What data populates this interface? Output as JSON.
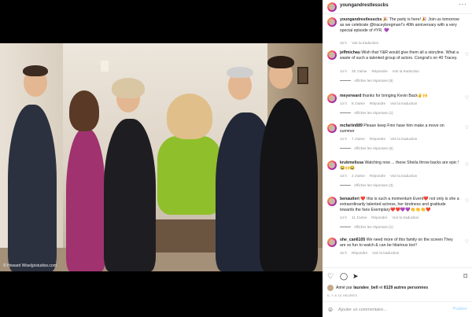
{
  "post": {
    "account": "youngandrestlesscbs",
    "photo_credit": "© Howard Wise/jpistudios.com",
    "caption": {
      "user": "youngandrestlesscbs",
      "text": "🎉 The party is here! 🎉 Join us tomorrow as we celebrate @traceybregman!'s 40th anniversary with a very special episode of #YR. 💜",
      "time": "15 h",
      "translate": "Voir la traduction"
    }
  },
  "comments": [
    {
      "user": "jeffmichau",
      "text": "Wish that Y&R would give them all a storyline. What a waste of such a talented group of actors. Congrat's on 40 Tracey.",
      "time": "14 h",
      "likes": "25 J'aime",
      "reply": "Répondre",
      "translate": "Voir la traduction",
      "replies": "Afficher les réponses (8)"
    },
    {
      "user": "meyerward",
      "text": "thanks for bringing Kevin Back✌️🙌",
      "time": "14 h",
      "likes": "8 J'aime",
      "reply": "Répondre",
      "translate": "Voir la traduction",
      "replies": "Afficher les réponses (1)"
    },
    {
      "user": "mcfarlin889",
      "text": "Please keep Finn have him make a move on summer",
      "time": "14 h",
      "likes": "7 J'aime",
      "reply": "Répondre",
      "translate": "Voir la traduction",
      "replies": "Afficher les réponses (6)"
    },
    {
      "user": "krukmelissa",
      "text": "Watching now ... these Sheila throw backs are epic ! 😂🙌😂",
      "time": "13 h",
      "likes": "2 J'aime",
      "reply": "Répondre",
      "translate": "Voir la traduction",
      "replies": "Afficher les réponses (3)"
    },
    {
      "user": "benautleri",
      "text": "❤️ this is such a momentum Event❤️ not only is she a extraordinarily talented actress, her kindness and gratitude towards the fans Exemplary❤️❤️💜💜👏👏👏❤️",
      "time": "14 h",
      "likes": "11 J'aime",
      "reply": "Répondre",
      "translate": "Voir la traduction",
      "replies": "Afficher les réponses (1)"
    },
    {
      "user": "she_can6105",
      "text": "We need more of this family on the screen They are so fun to watch & can be hilarious too!!",
      "time": "15 h",
      "likes": "",
      "reply": "Répondre",
      "translate": "Voir la traduction",
      "replies": ""
    }
  ],
  "likes": {
    "prefix": "Aimé par",
    "user": "lauralee_bell",
    "connector": "et",
    "others": "8129 autres personnes"
  },
  "date": "IL Y A 15 HEURES",
  "add_comment": {
    "placeholder": "Ajouter un commentaire...",
    "post": "Publier"
  },
  "icons": {
    "more": "more-icon",
    "heart": "heart-icon",
    "comment": "comment-icon",
    "share": "share-icon",
    "save": "bookmark-icon",
    "emoji": "emoji-icon"
  }
}
